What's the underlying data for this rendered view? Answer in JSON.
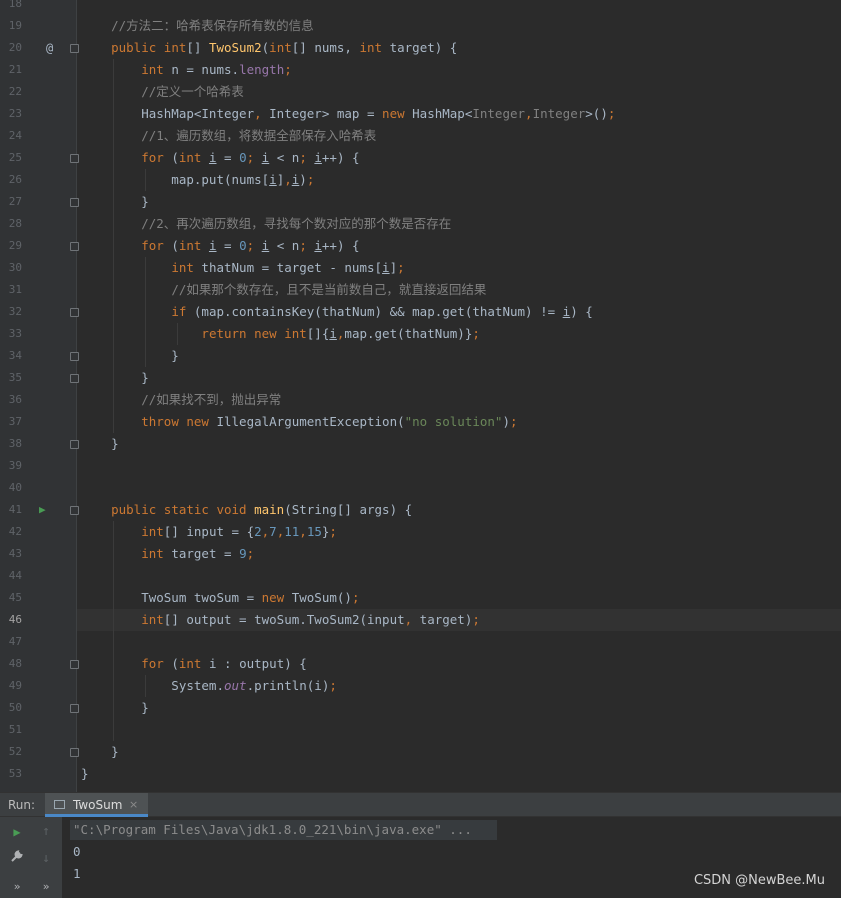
{
  "editor": {
    "line_numbers": [
      "18",
      "19",
      "20",
      "21",
      "22",
      "23",
      "24",
      "25",
      "26",
      "27",
      "28",
      "29",
      "30",
      "31",
      "32",
      "33",
      "34",
      "35",
      "36",
      "37",
      "38",
      "39",
      "40",
      "41",
      "42",
      "43",
      "44",
      "45",
      "46",
      "47",
      "48",
      "49",
      "50",
      "51",
      "52",
      "53"
    ],
    "current_line": "46",
    "gutter_marker_override": "@",
    "gutter_marker_run": "▶",
    "comments": {
      "c19": "//方法二：哈希表保存所有数的信息",
      "c22": "//定义一个哈希表",
      "c24": "//1、遍历数组，将数据全部保存入哈希表",
      "c28": "//2、再次遍历数组，寻找每个数对应的那个数是否存在",
      "c31": "//如果那个数存在，且不是当前数自己，就直接返回结果",
      "c36": "//如果找不到，抛出异常"
    },
    "strings": {
      "no_solution": "\"no solution\""
    }
  },
  "run_panel": {
    "label": "Run:",
    "tab_label": "TwoSum",
    "tab_close": "×",
    "command": "\"C:\\Program Files\\Java\\jdk1.8.0_221\\bin\\java.exe\" ...",
    "output_lines": [
      "0",
      "1"
    ],
    "buttons": {
      "rerun": "▶",
      "settings": "🔧",
      "up": "↑",
      "down": "↓",
      "more": "»"
    }
  },
  "watermark": "CSDN @NewBee.Mu",
  "colors": {
    "keyword": "#cc7832",
    "method": "#ffc66d",
    "number": "#6897bb",
    "string": "#6a8759",
    "comment": "#808080",
    "field": "#9876aa",
    "text": "#a9b7c6",
    "background": "#2b2b2b"
  }
}
